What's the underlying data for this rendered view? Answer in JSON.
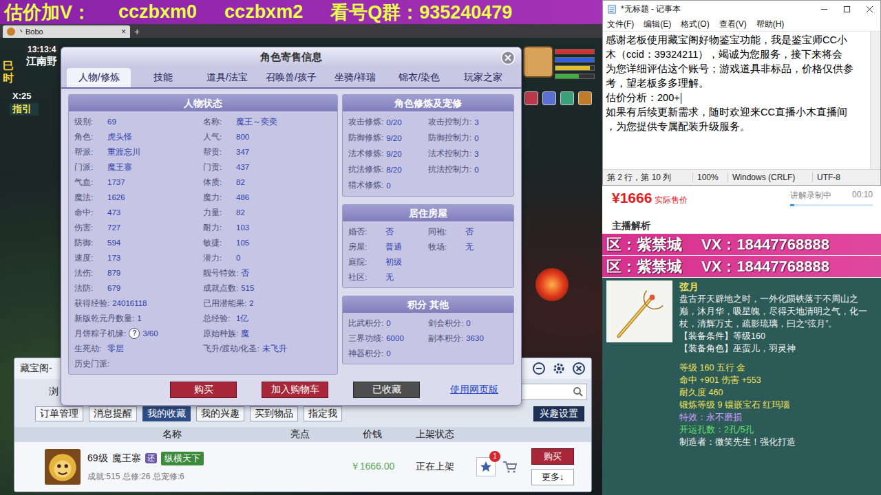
{
  "banner": {
    "parts": [
      "估价加V：",
      "cczbxm0",
      "cczbxm2",
      "看号Q群：935240479"
    ]
  },
  "game": {
    "tab": {
      "title": "丶Bobo",
      "close": "×",
      "add": "+"
    },
    "hud": {
      "time": "13:13:4",
      "place": "江南野",
      "period": "巳时",
      "coords": "X:25",
      "guide": "指引"
    },
    "status_bars": [
      {
        "level": 1,
        "color": "#d83030"
      },
      {
        "level": 1,
        "color": "#3060e0"
      },
      {
        "level": 0.9,
        "color": "#e0c030"
      },
      {
        "level": 0.6,
        "color": "#40b040"
      }
    ]
  },
  "dialog": {
    "title": "角色寄售信息",
    "tabs": [
      {
        "label": "人物/修炼",
        "selected": true
      },
      {
        "label": "技能",
        "selected": false
      },
      {
        "label": "道具/法宝",
        "selected": false
      },
      {
        "label": "召唤兽/孩子",
        "selected": false
      },
      {
        "label": "坐骑/祥瑞",
        "selected": false
      },
      {
        "label": "锦衣/染色",
        "selected": false
      },
      {
        "label": "玩家之家",
        "selected": false
      }
    ],
    "status": {
      "title": "人物状态",
      "rows": [
        [
          {
            "k": "级别:",
            "v": "69"
          },
          {
            "k": "名称:",
            "v": "魔王～奕奕"
          }
        ],
        [
          {
            "k": "角色:",
            "v": "虎头怪"
          },
          {
            "k": "人气:",
            "v": "800"
          }
        ],
        [
          {
            "k": "帮派:",
            "v": "重渡忘川"
          },
          {
            "k": "帮贡:",
            "v": "347"
          }
        ],
        [
          {
            "k": "门派:",
            "v": "魔王寨"
          },
          {
            "k": "门贡:",
            "v": "437"
          }
        ],
        [
          {
            "k": "气血:",
            "v": "1737"
          },
          {
            "k": "体质:",
            "v": "82"
          }
        ],
        [
          {
            "k": "魔法:",
            "v": "1626"
          },
          {
            "k": "魔力:",
            "v": "486"
          }
        ],
        [
          {
            "k": "命中:",
            "v": "473"
          },
          {
            "k": "力量:",
            "v": "82"
          }
        ],
        [
          {
            "k": "伤害:",
            "v": "727"
          },
          {
            "k": "耐力:",
            "v": "103"
          }
        ],
        [
          {
            "k": "防御:",
            "v": "594"
          },
          {
            "k": "敏捷:",
            "v": "105"
          }
        ],
        [
          {
            "k": "速度:",
            "v": "173"
          },
          {
            "k": "潜力:",
            "v": "0"
          }
        ],
        [
          {
            "k": "法伤:",
            "v": "879"
          },
          {
            "k": "靓号特效:",
            "v": "否"
          }
        ],
        [
          {
            "k": "法防:",
            "v": "679"
          },
          {
            "k": "成就点数:",
            "v": "515"
          }
        ],
        [
          {
            "k": "获得经验:",
            "v": "24016118"
          },
          {
            "k": "已用潜能果:",
            "v": "2"
          }
        ],
        [
          {
            "k": "新版乾元丹数量:",
            "v": "1"
          },
          {
            "k": "总经验:",
            "v": "1亿"
          }
        ],
        [
          {
            "k": "月饼粽子机缘:",
            "help": "?",
            "v": "3/60"
          },
          {
            "k": "原始种族:",
            "v": "魔"
          }
        ],
        [
          {
            "k": "生死劫:",
            "v": "零层"
          },
          {
            "k": "飞升/渡劫/化圣:",
            "v": "未飞升"
          }
        ],
        [
          {
            "k": "历史门派:"
          }
        ]
      ]
    },
    "cultivation": {
      "title": "角色修炼及宠修",
      "rows": [
        [
          {
            "k": "攻击修炼:",
            "v": "0/20"
          },
          {
            "k": "攻击控制力:",
            "v": "3"
          }
        ],
        [
          {
            "k": "防御修炼:",
            "v": "9/20"
          },
          {
            "k": "防御控制力:",
            "v": "0"
          }
        ],
        [
          {
            "k": "法术修炼:",
            "v": "9/20"
          },
          {
            "k": "法术控制力:",
            "v": "3"
          }
        ],
        [
          {
            "k": "抗法修炼:",
            "v": "8/20"
          },
          {
            "k": "抗法控制力:",
            "v": "0"
          }
        ],
        [
          {
            "k": "猎术修炼:",
            "v": "0"
          }
        ]
      ]
    },
    "house": {
      "title": "居住房屋",
      "rows": [
        [
          {
            "k": "婚否:",
            "v": "否"
          },
          {
            "k": "同袍:",
            "v": "否"
          }
        ],
        [
          {
            "k": "房屋:",
            "v": "普通"
          },
          {
            "k": "牧场:",
            "v": "无"
          }
        ],
        [
          {
            "k": "庭院:",
            "v": "初级"
          }
        ],
        [
          {
            "k": "社区:",
            "v": "无"
          }
        ]
      ]
    },
    "points": {
      "title": "积分 其他",
      "rows": [
        [
          {
            "k": "比武积分:",
            "v": "0"
          },
          {
            "k": "剑会积分:",
            "v": "0"
          }
        ],
        [
          {
            "k": "三界功绩:",
            "v": "6000"
          },
          {
            "k": "副本积分:",
            "v": "3630"
          }
        ],
        [
          {
            "k": "神器积分:",
            "v": "0"
          }
        ]
      ]
    },
    "buttons": [
      {
        "label": "购买",
        "kind": "buy"
      },
      {
        "label": "加入购物车",
        "kind": "buy"
      },
      {
        "label": "已收藏",
        "kind": "done"
      }
    ],
    "link": "使用网页版"
  },
  "cbg": {
    "title": "藏宝阁-",
    "search_hint": "浏",
    "nav": [
      {
        "label": "订单管理",
        "selected": false
      },
      {
        "label": "消息提醒",
        "selected": false
      },
      {
        "label": "我的收藏",
        "selected": true
      },
      {
        "label": "我的兴趣",
        "selected": false
      },
      {
        "label": "买到物品",
        "selected": false
      },
      {
        "label": "指定我",
        "selected": false
      }
    ],
    "settings": "兴趣设置",
    "columns": [
      "名称",
      "亮点",
      "价钱",
      "上架状态"
    ],
    "rows": [
      {
        "level": "69级",
        "school": "魔王寨",
        "badge": "还",
        "tag": "纵横天下",
        "summary": "成就:515 总修:26 总宠修:6",
        "price": "￥1666.00",
        "status": "正在上架",
        "fav_count": "1",
        "buy": "购买",
        "more": "更多↓"
      }
    ]
  },
  "notepad": {
    "title": "*无标题 - 记事本",
    "menu": [
      "文件(F)",
      "编辑(E)",
      "格式(O)",
      "查看(V)",
      "帮助(H)"
    ],
    "lines": [
      "感谢老板使用藏宝阁好物鉴宝功能，我是鉴宝师CC小",
      "木（ccid：39324211），竭诚为您服务，接下来将会",
      "为您详细评估这个账号；游戏道具非标品，价格仅供参",
      "考，望老板多多理解。",
      "估价分析：200+",
      "如果有后续更新需求，随时欢迎来CC直播小木直播间",
      "，为您提供专属配装升级服务。"
    ],
    "caret_line": 4,
    "status": [
      "第 2 行，第 10 列",
      "100%",
      "Windows (CRLF)",
      "UTF-8"
    ]
  },
  "price": {
    "amount": "¥1666",
    "label": "实际售价",
    "recording": "讲解录制中",
    "elapsed": "00:10",
    "level": 0.05,
    "analysis": "主播解析"
  },
  "ads": [
    {
      "region": "区：紫禁城",
      "contact": "VX：18447768888"
    },
    {
      "region": "区：紫禁城",
      "contact": "VX：18447768888"
    }
  ],
  "item": {
    "name": "弦月",
    "description": "盘古开天辟地之时，一外化陨铁落于不周山之巅，沐月华，吸星魄，尽得天地清明之气，化一杖，清辉万丈，疏影琉璃，曰之“弦月”。",
    "requirements": [
      "【装备条件】等级160",
      "【装备角色】巫蛮儿，羽灵神"
    ],
    "stats": [
      {
        "text": "等级 160  五行 金",
        "color": "#f2e35a"
      },
      {
        "text": "命中 +901 伤害 +553",
        "color": "#f2e35a"
      },
      {
        "text": "耐久度 460",
        "color": "#f2e35a"
      },
      {
        "text": "锻炼等级 9  镶嵌宝石 红玛瑙",
        "color": "#f2e35a"
      },
      {
        "text": "特效：永不磨损",
        "color": "#d49cff"
      },
      {
        "text": "开运孔数：2孔/5孔",
        "color": "#66e26a"
      },
      {
        "text": "制造者：微笑先生！强化打造",
        "color": "#f4f4f4"
      }
    ]
  }
}
